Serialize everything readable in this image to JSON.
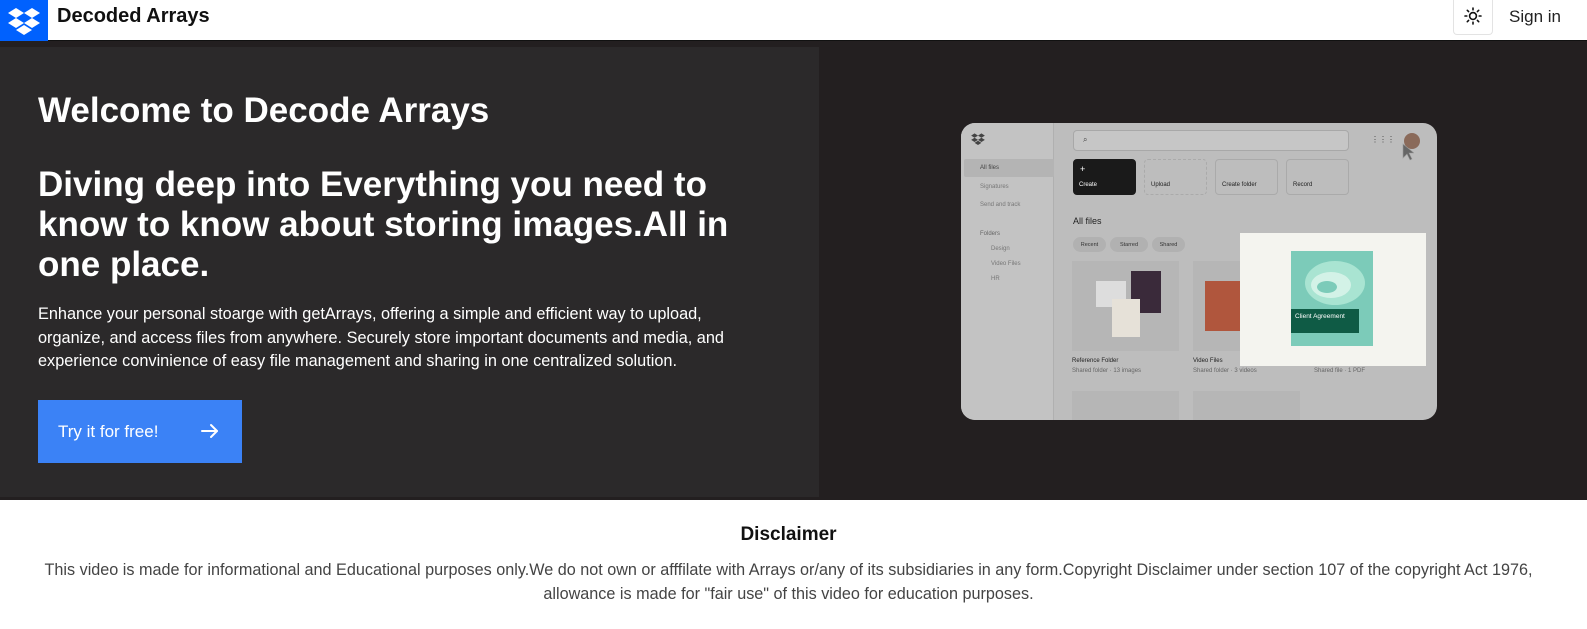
{
  "header": {
    "brand": "Decoded Arrays",
    "sign_in": "Sign in",
    "logo_icon": "dropbox-logo-icon",
    "theme_icon": "sun-icon"
  },
  "hero": {
    "title": "Welcome to Decode Arrays",
    "headline": "Diving deep into Everything you need to know to know about storing images.All in one place.",
    "description": "Enhance your personal stoarge with getArrays, offering a simple and efficient way to upload, organize, and access files from anywhere. Securely store important documents and media, and experience convinience of easy file management and sharing in one centralized solution.",
    "cta_label": "Try it for free!",
    "cta_icon": "arrow-right-icon"
  },
  "preview": {
    "sidebar": [
      "All files",
      "Signatures",
      "Send and track",
      "Folders",
      "Design",
      "Video Files",
      "HR"
    ],
    "actions": [
      "Create",
      "Upload",
      "Create folder",
      "Record"
    ],
    "section_title": "All files",
    "filters": [
      "Recent",
      "Starred",
      "Shared"
    ],
    "files": [
      {
        "name": "Reference Folder",
        "meta": "Shared folder · 13 images"
      },
      {
        "name": "Video Files",
        "meta": "Shared folder · 3 videos"
      },
      {
        "name": "",
        "meta": "Shared file · 1 PDF"
      }
    ],
    "card_label": "Client Agreement"
  },
  "disclaimer": {
    "title": "Disclaimer",
    "text": "This video is made for informational and Educational purposes only.We do not own or afffilate with Arrays or/any of its subsidiaries in any form.Copyright Disclaimer under section 107 of the copyright Act 1976, allowance is made for \"fair use\" of this video for education purposes."
  },
  "colors": {
    "brand_blue": "#0061fe",
    "cta_blue": "#3b82f6",
    "hero_dark": "#231f20",
    "hero_panel": "#2b292a"
  }
}
